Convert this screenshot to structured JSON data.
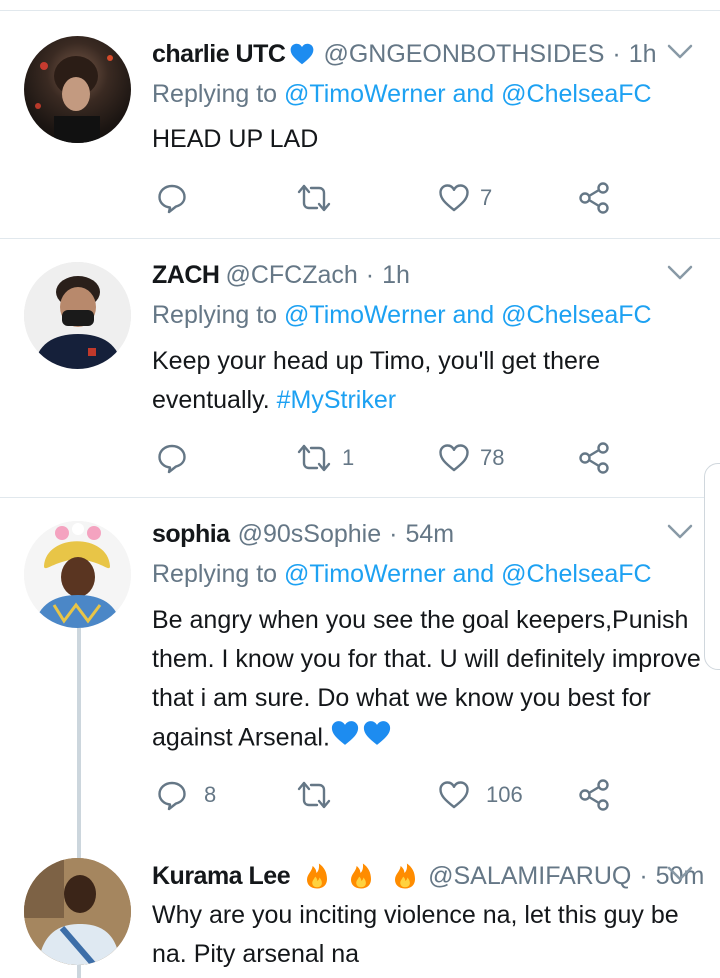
{
  "tweets": [
    {
      "name": "charlie UTC",
      "emoji": "blue-heart",
      "handle": "@GNGEONBOTHSIDES",
      "dot": "·",
      "time": "1h",
      "replying_prefix": "Replying to",
      "replying_user1": "@TimoWerner",
      "replying_and": "and",
      "replying_user2": "@ChelseaFC",
      "text": "HEAD UP LAD",
      "reply_count": "",
      "retweet_count": "",
      "like_count": "7"
    },
    {
      "name": "ZACH",
      "handle": "@CFCZach",
      "dot": "·",
      "time": "1h",
      "replying_prefix": "Replying to",
      "replying_user1": "@TimoWerner",
      "replying_and": "and",
      "replying_user2": "@ChelseaFC",
      "text": "Keep your head up Timo, you'll get there eventually.",
      "hashtag": "#MyStriker",
      "reply_count": "",
      "retweet_count": "1",
      "like_count": "78"
    },
    {
      "name": "sophia",
      "handle": "@90sSophie",
      "dot": "·",
      "time": "54m",
      "replying_prefix": "Replying to",
      "replying_user1": "@TimoWerner",
      "replying_and": "and",
      "replying_user2": "@ChelseaFC",
      "text": "Be angry when you see the goal keepers,Punish them. I know you for that. U will definitely improve that i am sure. Do what we know you best for against Arsenal.",
      "emoji": "blue-heart",
      "reply_count": "8",
      "retweet_count": "",
      "like_count": "106"
    },
    {
      "name": "Kurama Lee",
      "emoji": "fire",
      "handle": "@SALAMIFARUQ",
      "dot": "·",
      "time": "50m",
      "text": "Why are you inciting violence na, let this guy be na. Pity arsenal na"
    }
  ],
  "colors": {
    "accent": "#1da1f2",
    "muted": "#657786",
    "text": "#14171a",
    "heart_emoji": "#1d8cf0",
    "fire_emoji": "#ff8c00"
  }
}
